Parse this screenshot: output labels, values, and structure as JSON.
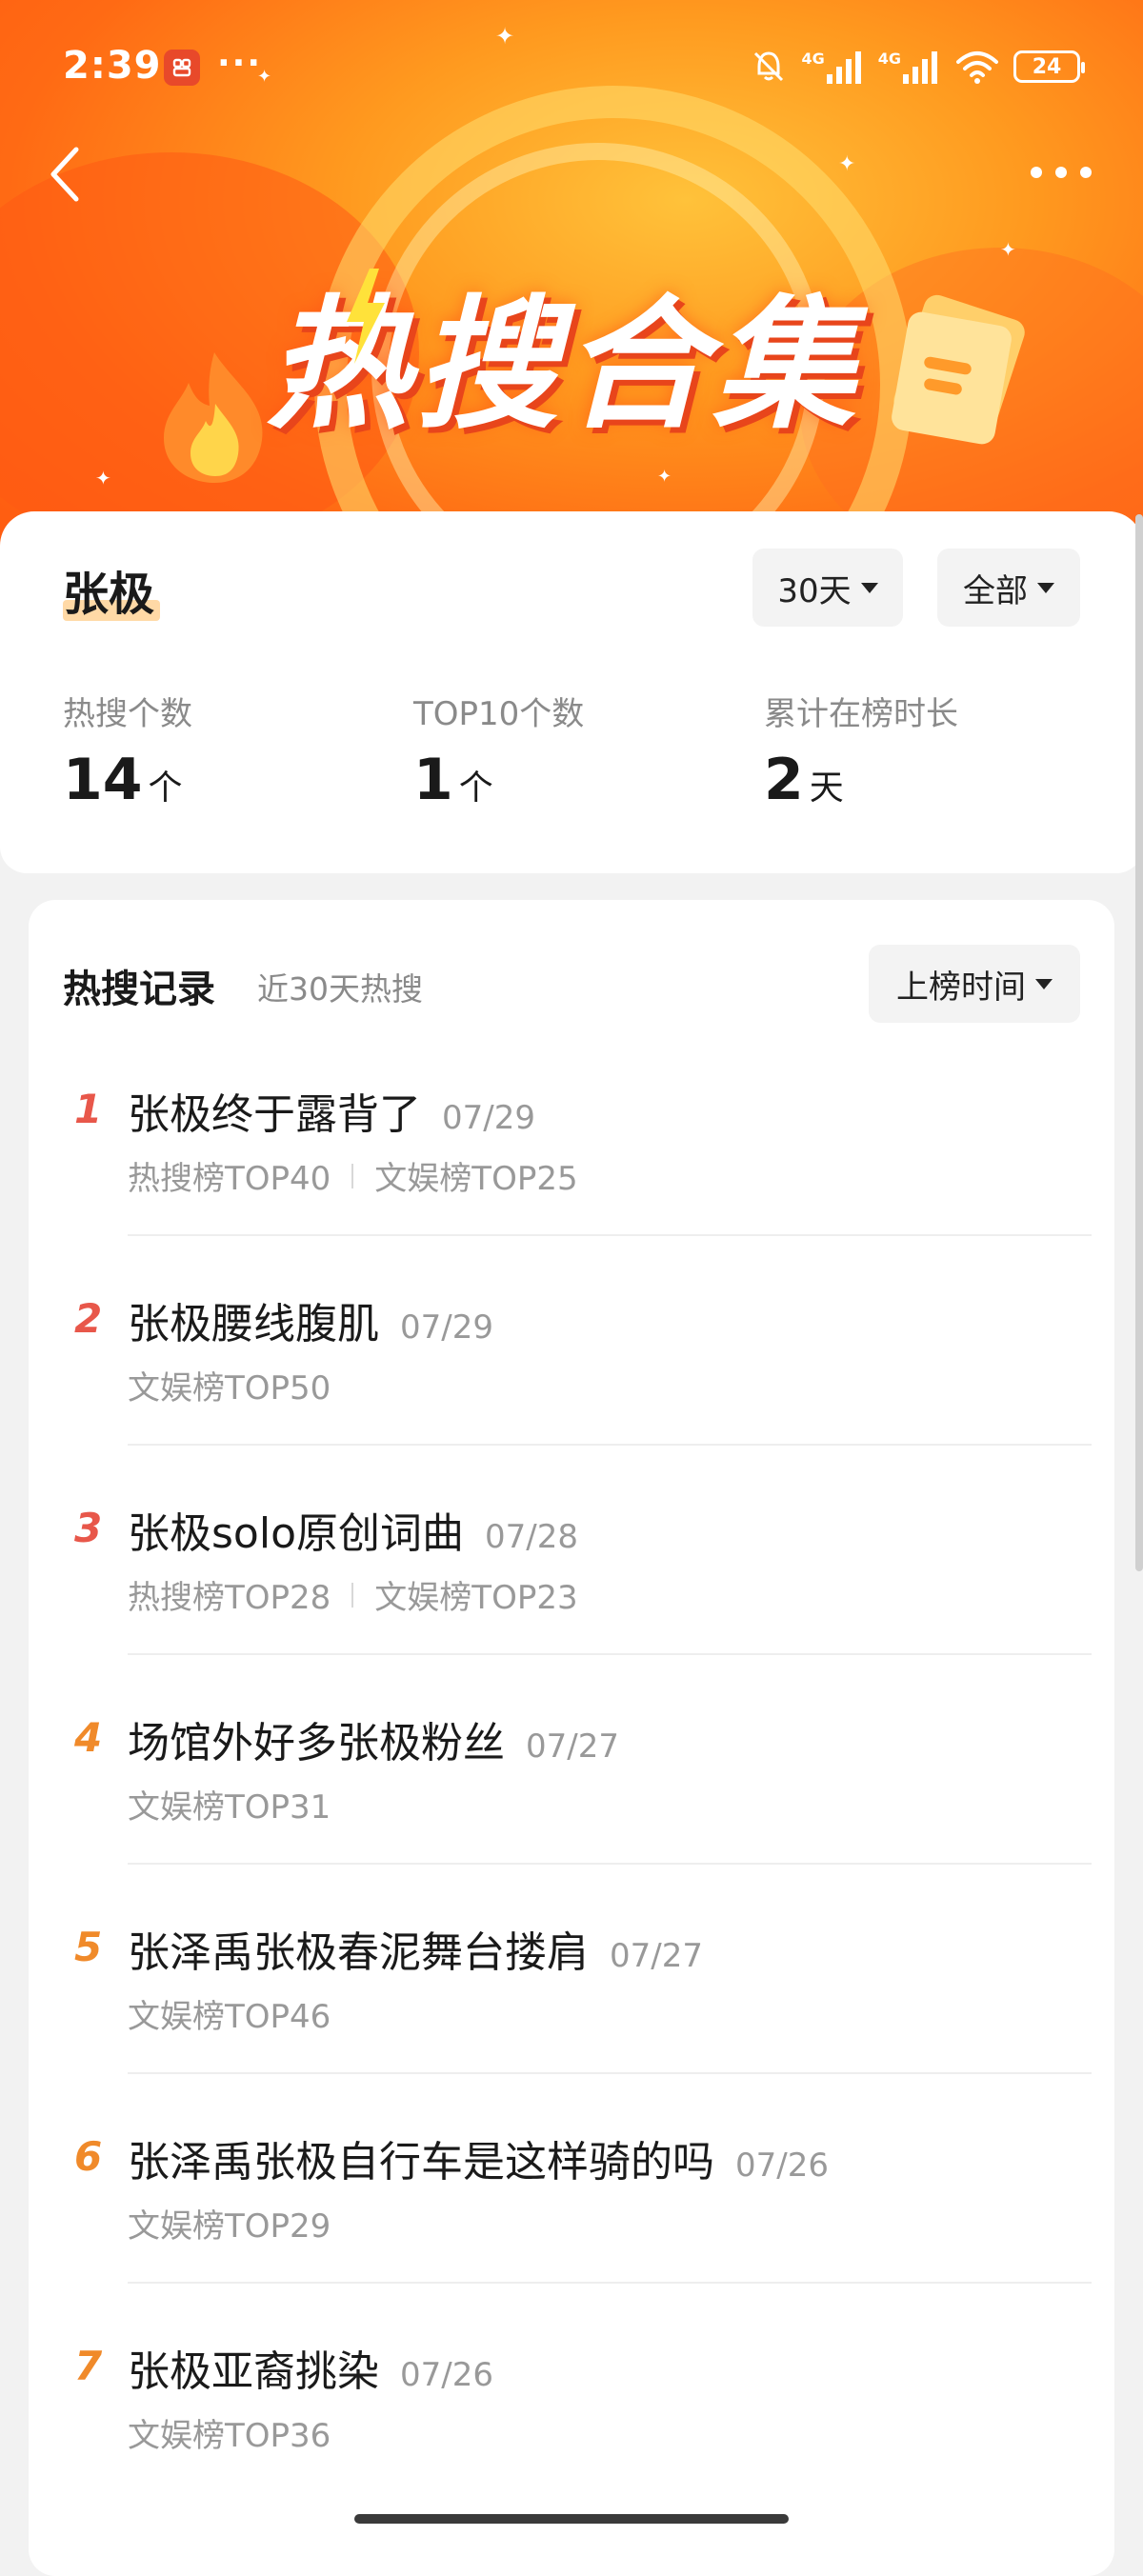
{
  "status_bar": {
    "time": "2:39",
    "dots": "···",
    "network_1": "4G",
    "network_2": "4G",
    "battery": "24"
  },
  "header": {
    "title": "热搜合集"
  },
  "summary": {
    "name": "张极",
    "filters": [
      {
        "label": "30天"
      },
      {
        "label": "全部"
      }
    ],
    "stats": [
      {
        "label": "热搜个数",
        "value": "14",
        "unit": "个"
      },
      {
        "label": "TOP10个数",
        "value": "1",
        "unit": "个"
      },
      {
        "label": "累计在榜时长",
        "value": "2",
        "unit": "天"
      }
    ]
  },
  "records": {
    "title": "热搜记录",
    "subtitle": "近30天热搜",
    "sort_label": "上榜时间",
    "items": [
      {
        "rank": "1",
        "topic": "张极终于露背了",
        "date": "07/29",
        "tags": [
          "热搜榜TOP40",
          "文娱榜TOP25"
        ]
      },
      {
        "rank": "2",
        "topic": "张极腰线腹肌",
        "date": "07/29",
        "tags": [
          "文娱榜TOP50"
        ]
      },
      {
        "rank": "3",
        "topic": "张极solo原创词曲",
        "date": "07/28",
        "tags": [
          "热搜榜TOP28",
          "文娱榜TOP23"
        ]
      },
      {
        "rank": "4",
        "topic": "场馆外好多张极粉丝",
        "date": "07/27",
        "tags": [
          "文娱榜TOP31"
        ]
      },
      {
        "rank": "5",
        "topic": "张泽禹张极春泥舞台搂肩",
        "date": "07/27",
        "tags": [
          "文娱榜TOP46"
        ]
      },
      {
        "rank": "6",
        "topic": "张泽禹张极自行车是这样骑的吗",
        "date": "07/26",
        "tags": [
          "文娱榜TOP29"
        ]
      },
      {
        "rank": "7",
        "topic": "张极亚裔挑染",
        "date": "07/26",
        "tags": [
          "文娱榜TOP36"
        ]
      }
    ]
  },
  "colors": {
    "banner_orange": "#ff7a1a",
    "rank_hot": "#e8574a",
    "rank_warm": "#f08a2a"
  }
}
